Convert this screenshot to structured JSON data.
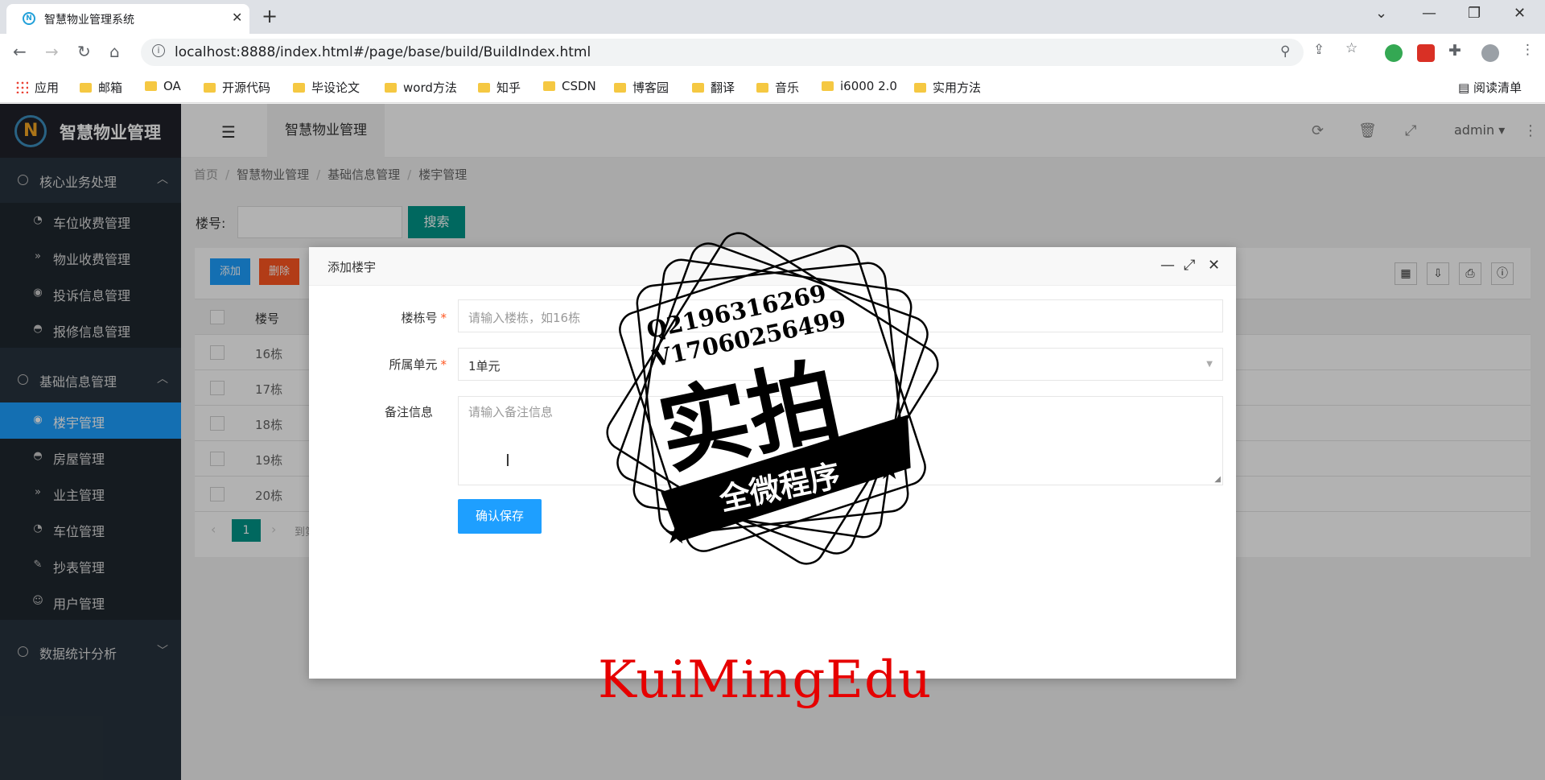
{
  "browser": {
    "tab_title": "智慧物业管理系统",
    "url": "localhost:8888/index.html#/page/base/build/BuildIndex.html",
    "bookmarks": [
      "应用",
      "邮箱",
      "OA",
      "开源代码",
      "毕设论文",
      "word方法",
      "知乎",
      "CSDN",
      "博客园",
      "翻译",
      "音乐",
      "i6000 2.0",
      "实用方法"
    ],
    "reading_list": "阅读清单"
  },
  "app": {
    "logo_text": "智慧物业管理",
    "top_tab": "智慧物业管理",
    "user": "admin"
  },
  "sidebar": {
    "groups": [
      {
        "label": "核心业务处理",
        "items": [
          "车位收费管理",
          "物业收费管理",
          "投诉信息管理",
          "报修信息管理"
        ]
      },
      {
        "label": "基础信息管理",
        "items": [
          "楼宇管理",
          "房屋管理",
          "业主管理",
          "车位管理",
          "抄表管理",
          "用户管理"
        ]
      },
      {
        "label": "数据统计分析",
        "items": []
      }
    ],
    "active_item": "楼宇管理"
  },
  "breadcrumb": [
    "首页",
    "智慧物业管理",
    "基础信息管理",
    "楼宇管理"
  ],
  "search": {
    "label": "楼号:",
    "button": "搜索"
  },
  "table": {
    "add_button": "添加",
    "delete_button": "删除",
    "column": "楼号",
    "rows": [
      "16栋",
      "17栋",
      "18栋",
      "19栋",
      "20栋"
    ],
    "page": "1",
    "goto_prefix": "到第"
  },
  "modal": {
    "title": "添加楼宇",
    "fields": {
      "building_label": "楼栋号",
      "building_placeholder": "请输入楼栋，如16栋",
      "unit_label": "所属单元",
      "unit_value": "1单元",
      "remark_label": "备注信息",
      "remark_placeholder": "请输入备注信息"
    },
    "save_button": "确认保存"
  },
  "watermark": {
    "qq": "Q2196316269",
    "vx": "V17060256499",
    "main": "实拍",
    "ribbon": "全微程序",
    "brand": "KuiMingEdu"
  },
  "colors": {
    "sidebar_bg": "#28333e",
    "active_blue": "#1e9fff",
    "primary_green": "#009688",
    "danger_red": "#ff5722",
    "watermark_red": "#e60000"
  }
}
